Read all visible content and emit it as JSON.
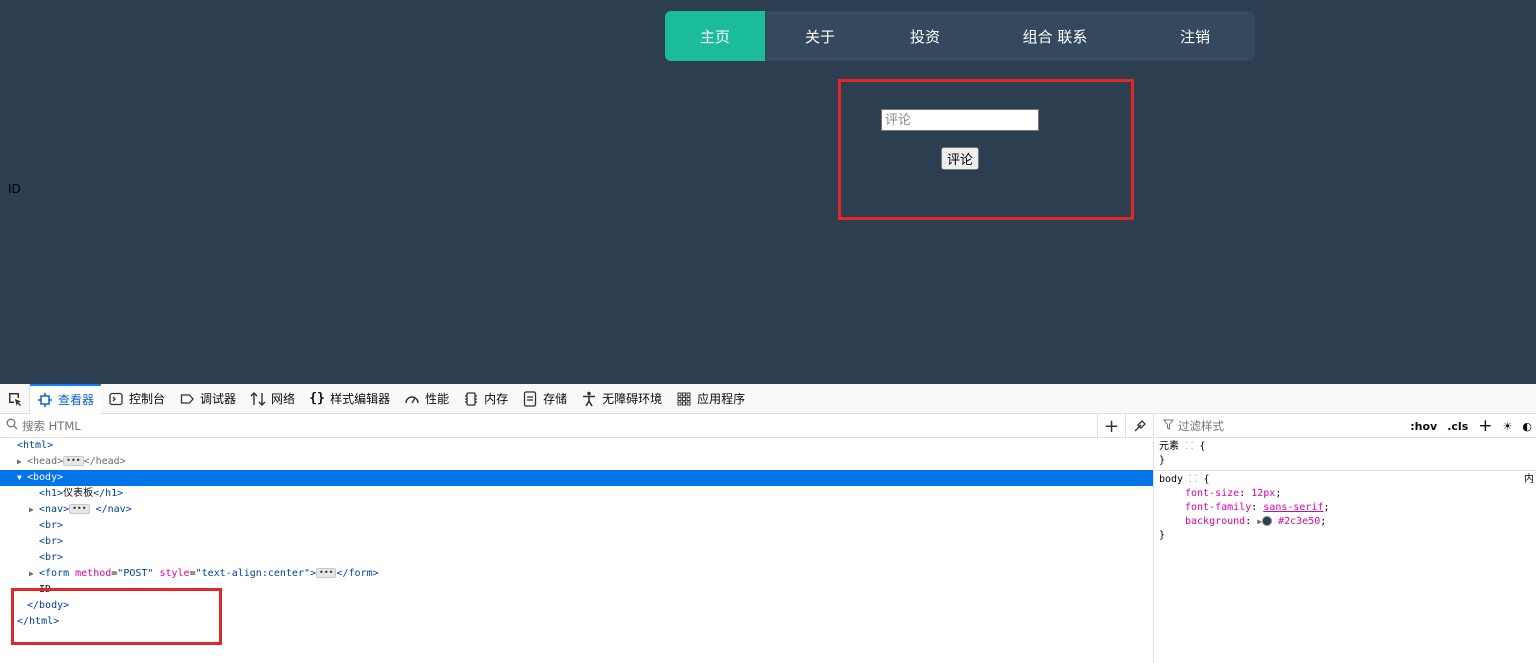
{
  "page": {
    "nav": [
      {
        "label": "主页",
        "active": true
      },
      {
        "label": "关于"
      },
      {
        "label": "投资"
      },
      {
        "label": "组合 联系"
      },
      {
        "label": "注销"
      }
    ],
    "form": {
      "input_placeholder": "评论",
      "submit_label": "评论"
    },
    "id_text": "ID",
    "background": "#2c3e50",
    "nav_active_color": "#1abc9c",
    "highlight_color": "#e3262a"
  },
  "devtools": {
    "tabs": [
      {
        "label": "查看器",
        "icon": "inspector-icon",
        "selected": true
      },
      {
        "label": "控制台",
        "icon": "console-icon"
      },
      {
        "label": "调试器",
        "icon": "debugger-icon"
      },
      {
        "label": "网络",
        "icon": "network-icon"
      },
      {
        "label": "样式编辑器",
        "icon": "style-editor-icon"
      },
      {
        "label": "性能",
        "icon": "performance-icon"
      },
      {
        "label": "内存",
        "icon": "memory-icon"
      },
      {
        "label": "存储",
        "icon": "storage-icon"
      },
      {
        "label": "无障碍环境",
        "icon": "accessibility-icon"
      },
      {
        "label": "应用程序",
        "icon": "application-icon"
      }
    ],
    "search_placeholder": "搜索 HTML",
    "markup": {
      "html_open": "<html>",
      "head_open": "<head>",
      "head_close": "</head>",
      "body_open": "<body>",
      "h1_open": "<h1>",
      "h1_text": "仪表板",
      "h1_close": "</h1>",
      "nav_open": "<nav>",
      "nav_close": "</nav>",
      "br": "<br>",
      "br_partial": "<br>",
      "form_tag": "<form",
      "form_attr1_name": "method",
      "form_attr1_value": "\"POST\"",
      "form_attr2_name": "style",
      "form_attr2_value": "\"text-align:center\"",
      "form_open_end": ">",
      "form_close": "</form>",
      "id_text": "ID",
      "body_close": "</body>",
      "html_close": "</html>"
    },
    "rules": {
      "filter_placeholder": "过滤样式",
      "hov": ":hov",
      "cls": ".cls",
      "element_selector": "元素",
      "open_brace": "{",
      "close_brace": "}",
      "body_selector": "body",
      "body_source": "内",
      "props": [
        {
          "name": "font-size",
          "value": "12px"
        },
        {
          "name": "font-family",
          "value": "sans-serif"
        },
        {
          "name": "background",
          "value": "#2c3e50"
        }
      ]
    }
  }
}
